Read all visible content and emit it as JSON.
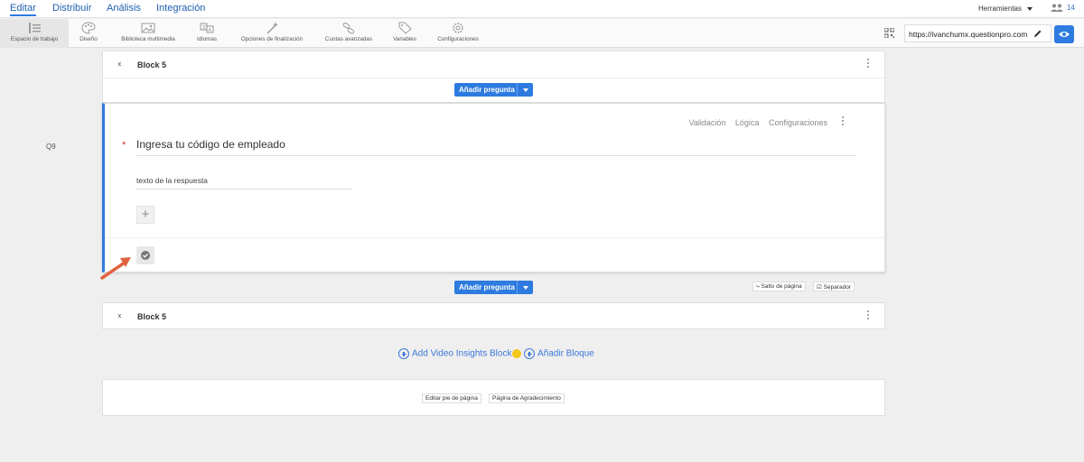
{
  "nav": {
    "tabs": [
      "Editar",
      "Distribuir",
      "Análisis",
      "Integración"
    ],
    "active": 0,
    "tools_label": "Herramientas",
    "users_count": "14"
  },
  "toolbar": {
    "items": [
      {
        "label": "Espacio de trabajo",
        "icon": "workspace-icon"
      },
      {
        "label": "Diseño",
        "icon": "palette-icon"
      },
      {
        "label": "Biblioteca multimedia",
        "icon": "image-icon"
      },
      {
        "label": "Idiomas",
        "icon": "language-icon"
      },
      {
        "label": "Opciones de finalización",
        "icon": "magic-wand-icon"
      },
      {
        "label": "Cuotas avanzadas",
        "icon": "link-icon"
      },
      {
        "label": "Variables",
        "icon": "tag-icon"
      },
      {
        "label": "Configuraciones",
        "icon": "gear-icon"
      }
    ],
    "url": "https://ivanchumx.questionpro.com"
  },
  "blocks": {
    "top_name": "Block 5",
    "bottom_name": "Block 5",
    "add_question_label": "Añadir pregunta"
  },
  "question": {
    "number": "Q9",
    "title": "Ingresa tu código de empleado",
    "answer_placeholder": "texto de la respuesta",
    "links": [
      "Validación",
      "Lógica",
      "Configuraciones"
    ]
  },
  "page_break_label": "Salto de página",
  "separator_label": "Separador",
  "add_video_label": "Add Video Insights Block",
  "add_block_label": "Añadir Bloque",
  "footer": {
    "edit_footer_label": "Editar pie de página",
    "thanks_page_label": "Página de Agradecimiento"
  },
  "colors": {
    "accent": "#2d7be0",
    "required": "#d0312d",
    "arrow": "#e0623f"
  }
}
